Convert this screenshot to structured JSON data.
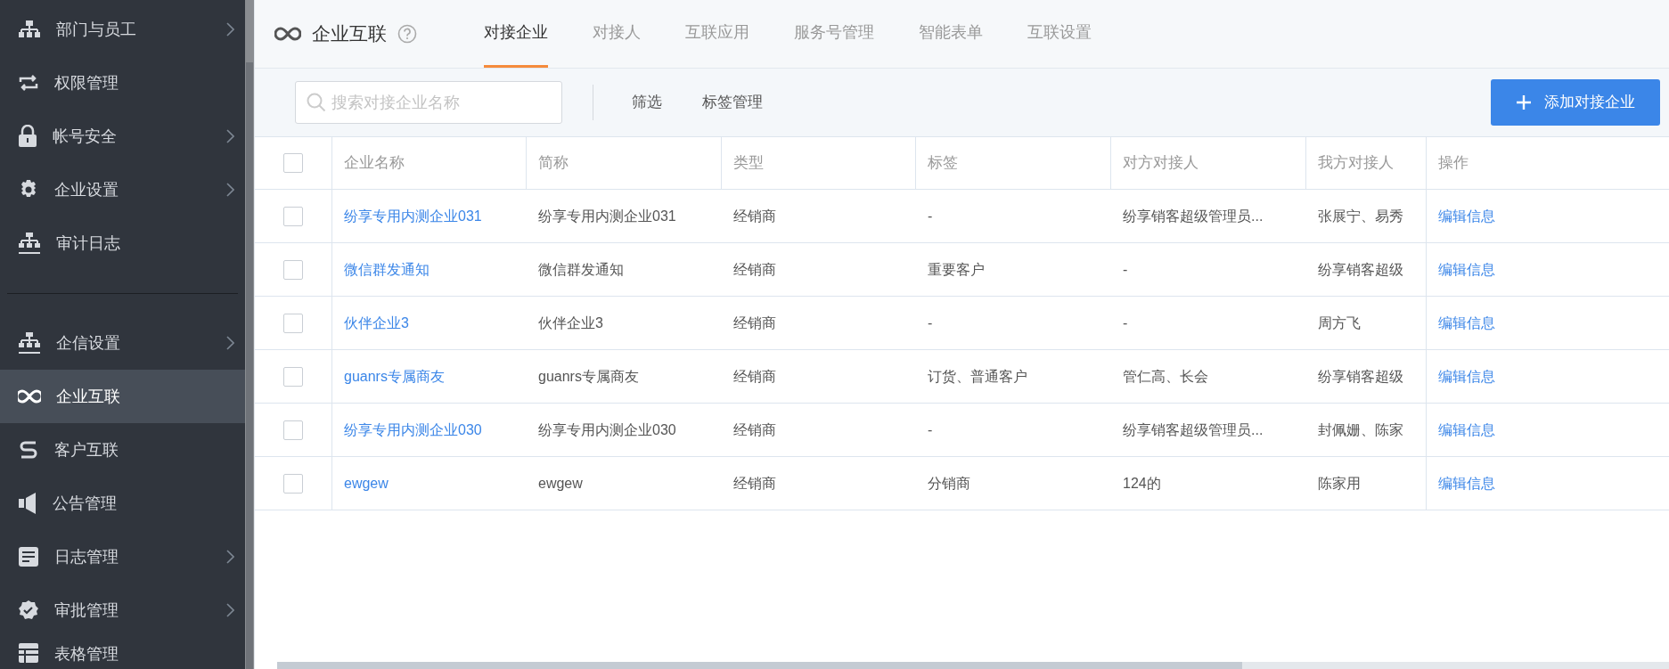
{
  "sidebar": {
    "groups": [
      {
        "items": [
          {
            "label": "部门与员工",
            "selected": false,
            "expandable": true
          },
          {
            "label": "权限管理",
            "selected": false,
            "expandable": false
          },
          {
            "label": "帐号安全",
            "selected": false,
            "expandable": true
          },
          {
            "label": "企业设置",
            "selected": false,
            "expandable": true
          },
          {
            "label": "审计日志",
            "selected": false,
            "expandable": false
          }
        ]
      },
      {
        "items": [
          {
            "label": "企信设置",
            "selected": false,
            "expandable": true
          },
          {
            "label": "企业互联",
            "selected": true,
            "expandable": false
          },
          {
            "label": "客户互联",
            "selected": false,
            "expandable": false
          },
          {
            "label": "公告管理",
            "selected": false,
            "expandable": false
          },
          {
            "label": "日志管理",
            "selected": false,
            "expandable": true
          },
          {
            "label": "审批管理",
            "selected": false,
            "expandable": true
          },
          {
            "label": "表格管理",
            "selected": false,
            "expandable": false
          }
        ]
      }
    ]
  },
  "header": {
    "title": "企业互联",
    "tabs": [
      {
        "label": "对接企业",
        "selected": true
      },
      {
        "label": "对接人",
        "selected": false
      },
      {
        "label": "互联应用",
        "selected": false
      },
      {
        "label": "服务号管理",
        "selected": false
      },
      {
        "label": "智能表单",
        "selected": false
      },
      {
        "label": "互联设置",
        "selected": false
      }
    ]
  },
  "toolbar": {
    "search": {
      "placeholder": "搜索对接企业名称"
    },
    "links": [
      "筛选",
      "标签管理"
    ],
    "add_button": "添加对接企业"
  },
  "table": {
    "all_checked": false,
    "columns": [
      "企业名称",
      "简称",
      "类型",
      "标签",
      "对方对接人",
      "我方对接人",
      "操作"
    ],
    "rows": [
      {
        "checked": false,
        "cells": [
          "纷享专用内测企业031",
          "纷享专用内测企业031",
          "经销商",
          "-",
          "纷享销客超级管理员...",
          "张展宁、易秀",
          "编辑信息"
        ]
      },
      {
        "checked": false,
        "cells": [
          "微信群发通知",
          "微信群发通知",
          "经销商",
          "重要客户",
          "-",
          "纷享销客超级",
          "编辑信息"
        ]
      },
      {
        "checked": false,
        "cells": [
          "伙伴企业3",
          "伙伴企业3",
          "经销商",
          "-",
          "-",
          "周方飞",
          "编辑信息"
        ]
      },
      {
        "checked": false,
        "cells": [
          "guanrs专属商友",
          "guanrs专属商友",
          "经销商",
          "订货、普通客户",
          "管仁高、长会",
          "纷享销客超级",
          "编辑信息"
        ]
      },
      {
        "checked": false,
        "cells": [
          "纷享专用内测企业030",
          "纷享专用内测企业030",
          "经销商",
          "-",
          "纷享销客超级管理员...",
          "封佩姗、陈家",
          "编辑信息"
        ]
      },
      {
        "checked": false,
        "cells": [
          "ewgew",
          "ewgew",
          "经销商",
          "分销商",
          "124的",
          "陈家用",
          "编辑信息"
        ]
      }
    ]
  }
}
